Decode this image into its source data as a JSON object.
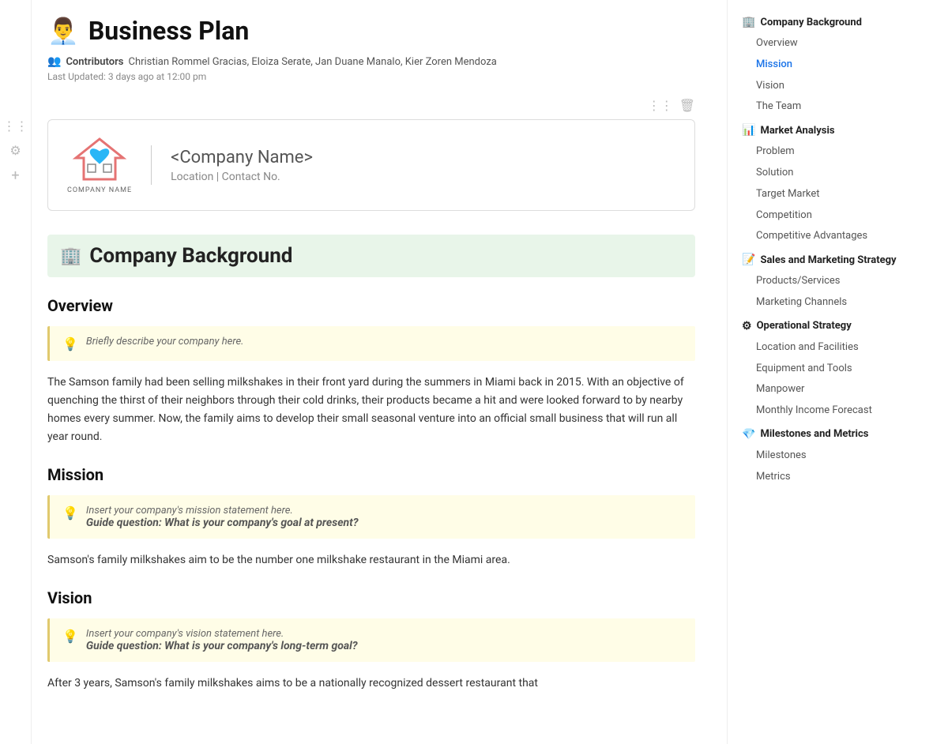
{
  "page": {
    "emoji": "👨‍💼",
    "title": "Business Plan",
    "contributors_label": "Contributors",
    "contributors": "Christian Rommel Gracias, Eloiza Serate, Jan Duane Manalo, Kier Zoren Mendoza",
    "last_updated": "Last Updated: 3 days ago at 12:00 pm"
  },
  "toolbar": {
    "grid_icon": "⋮⋮",
    "trash_icon": "🗑",
    "settings_icon": "⚙",
    "add_icon": "+"
  },
  "company_card": {
    "logo_label": "COMPANY NAME",
    "name": "<Company Name>",
    "location_contact": "Location | Contact No."
  },
  "sections": {
    "company_background": {
      "emoji": "🏢",
      "title": "Company Background"
    }
  },
  "overview": {
    "heading": "Overview",
    "callout_hint": "Briefly describe your company here.",
    "body_text": "The Samson family had been selling milkshakes in their front yard during the summers in Miami back in 2015. With an objective of quenching the thirst of their neighbors through their cold drinks, their products became a hit and were looked forward to by nearby homes every summer. Now, the family aims to develop their small seasonal venture into an official small business that will run all year round."
  },
  "mission": {
    "heading": "Mission",
    "callout_line1": "Insert your company's mission statement here.",
    "callout_line2": "Guide question: What is your company's goal at present?",
    "body_text": "Samson's family milkshakes aim to be the number one milkshake restaurant in the Miami area."
  },
  "vision": {
    "heading": "Vision",
    "callout_line1": "Insert your company's vision statement here.",
    "callout_line2": "Guide question: What is your company's long-term goal?",
    "body_text": "After 3 years, Samson's family milkshakes aims to be a nationally recognized dessert restaurant that"
  },
  "right_sidebar": {
    "sections": [
      {
        "id": "company-background",
        "emoji": "🏢",
        "label": "Company Background",
        "items": [
          {
            "id": "overview",
            "label": "Overview",
            "active": false
          },
          {
            "id": "mission",
            "label": "Mission",
            "active": true
          },
          {
            "id": "vision",
            "label": "Vision",
            "active": false
          },
          {
            "id": "the-team",
            "label": "The Team",
            "active": false
          }
        ]
      },
      {
        "id": "market-analysis",
        "emoji": "📊",
        "label": "Market Analysis",
        "items": [
          {
            "id": "problem",
            "label": "Problem",
            "active": false
          },
          {
            "id": "solution",
            "label": "Solution",
            "active": false
          },
          {
            "id": "target-market",
            "label": "Target Market",
            "active": false
          },
          {
            "id": "competition",
            "label": "Competition",
            "active": false
          },
          {
            "id": "competitive-advantages",
            "label": "Competitive Advantages",
            "active": false
          }
        ]
      },
      {
        "id": "sales-marketing",
        "emoji": "📝",
        "label": "Sales and Marketing Strategy",
        "items": [
          {
            "id": "products-services",
            "label": "Products/Services",
            "active": false
          },
          {
            "id": "marketing-channels",
            "label": "Marketing Channels",
            "active": false
          }
        ]
      },
      {
        "id": "operational-strategy",
        "emoji": "⚙",
        "label": "Operational Strategy",
        "items": [
          {
            "id": "location-facilities",
            "label": "Location and Facilities",
            "active": false
          },
          {
            "id": "equipment-tools",
            "label": "Equipment and Tools",
            "active": false
          },
          {
            "id": "manpower",
            "label": "Manpower",
            "active": false
          },
          {
            "id": "monthly-income-forecast",
            "label": "Monthly Income Forecast",
            "active": false
          }
        ]
      },
      {
        "id": "milestones-metrics",
        "emoji": "💎",
        "label": "Milestones and Metrics",
        "items": [
          {
            "id": "milestones",
            "label": "Milestones",
            "active": false
          },
          {
            "id": "metrics",
            "label": "Metrics",
            "active": false
          }
        ]
      }
    ]
  }
}
